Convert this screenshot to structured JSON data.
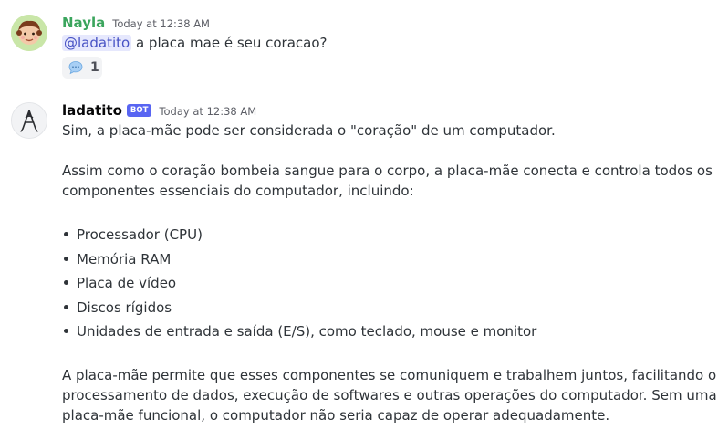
{
  "message1": {
    "username": "Nayla",
    "username_color": "#3ba55d",
    "timestamp": "Today at 12:38 AM",
    "mention": "@ladatito",
    "text": "a placa mae é seu coracao?",
    "reaction": {
      "emoji": "speech-bubble-icon",
      "count": "1"
    }
  },
  "message2": {
    "username": "ladatito",
    "username_color": "#060607",
    "bot_tag": "BOT",
    "timestamp": "Today at 12:38 AM",
    "p1": "Sim, a placa-mãe pode ser considerada o \"coração\" de um computador.",
    "p2_line1": "Assim como o coração bombeia sangue para o corpo, a placa-mãe conecta e controla todos os",
    "p2_line2": "componentes essenciais do computador, incluindo:",
    "bullets": [
      "Processador (CPU)",
      "Memória RAM",
      "Placa de vídeo",
      "Discos rígidos",
      "Unidades de entrada e saída (E/S), como teclado, mouse e monitor"
    ],
    "p3_line1": "A placa-mãe permite que esses componentes se comuniquem e trabalhem juntos, facilitando o",
    "p3_line2": "processamento de dados, execução de softwares e outras operações do computador. Sem uma",
    "p3_line3": "placa-mãe funcional, o computador não seria capaz de operar adequadamente."
  }
}
